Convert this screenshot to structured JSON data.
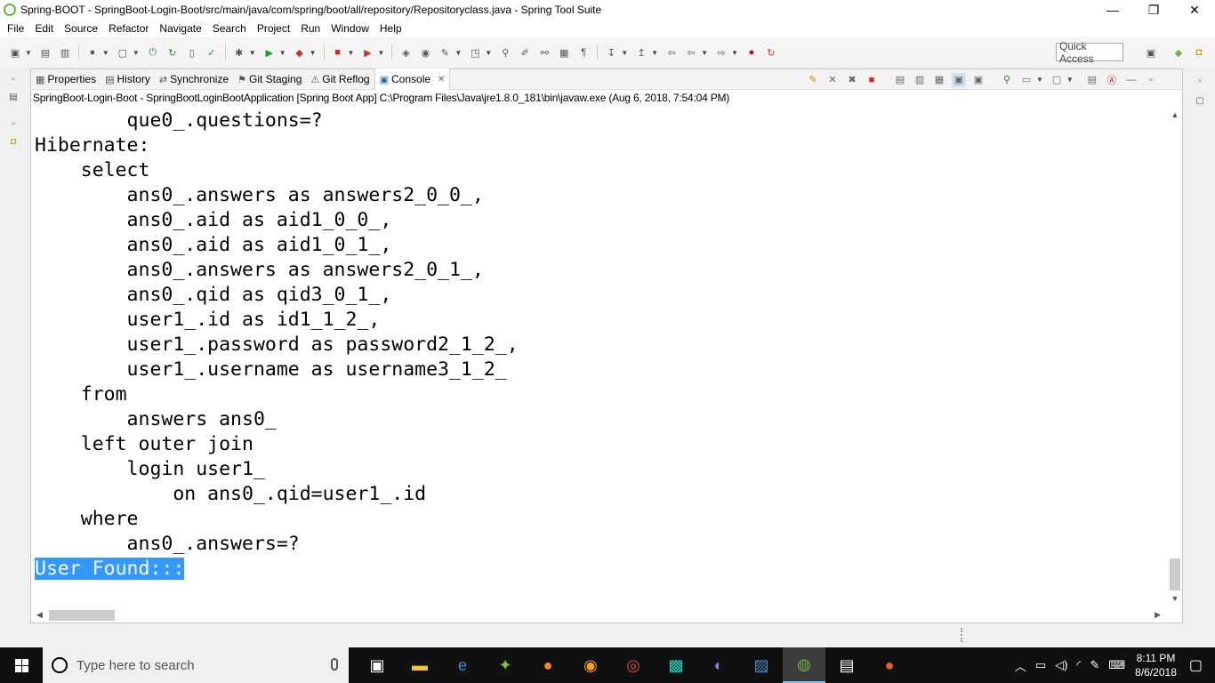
{
  "window": {
    "title": "Spring-BOOT - SpringBoot-Login-Boot/src/main/java/com/spring/boot/all/repository/Repositoryclass.java - Spring Tool Suite",
    "minimize": "—",
    "maximize": "❐",
    "close": "✕"
  },
  "menu": [
    "File",
    "Edit",
    "Source",
    "Refactor",
    "Navigate",
    "Search",
    "Project",
    "Run",
    "Window",
    "Help"
  ],
  "toolbar": {
    "quick_access_label": "Quick Access"
  },
  "tabs": [
    {
      "label": "Properties",
      "icon": "properties-icon"
    },
    {
      "label": "History",
      "icon": "history-icon"
    },
    {
      "label": "Synchronize",
      "icon": "synchronize-icon"
    },
    {
      "label": "Git Staging",
      "icon": "git-staging-icon"
    },
    {
      "label": "Git Reflog",
      "icon": "git-reflog-icon"
    },
    {
      "label": "Console",
      "icon": "console-icon",
      "active": true
    }
  ],
  "console": {
    "launch_info": "SpringBoot-Login-Boot - SpringBootLoginBootApplication [Spring Boot App] C:\\Program Files\\Java\\jre1.8.0_181\\bin\\javaw.exe (Aug 6, 2018, 7:54:04 PM)",
    "lines": [
      "        que0_.questions=?",
      "Hibernate: ",
      "    select",
      "        ans0_.answers as answers2_0_0_,",
      "        ans0_.aid as aid1_0_0_,",
      "        ans0_.aid as aid1_0_1_,",
      "        ans0_.answers as answers2_0_1_,",
      "        ans0_.qid as qid3_0_1_,",
      "        user1_.id as id1_1_2_,",
      "        user1_.password as password2_1_2_,",
      "        user1_.username as username3_1_2_ ",
      "    from",
      "        answers ans0_ ",
      "    left outer join",
      "        login user1_ ",
      "            on ans0_.qid=user1_.id ",
      "    where",
      "        ans0_.answers=?"
    ],
    "highlighted_line": "User Found:::"
  },
  "taskbar": {
    "search_placeholder": "Type here to search",
    "time": "8:11 PM",
    "date": "8/6/2018"
  },
  "colors": {
    "selection": "#3399ff",
    "taskbar": "#101010",
    "spring_green": "#6db33f"
  }
}
